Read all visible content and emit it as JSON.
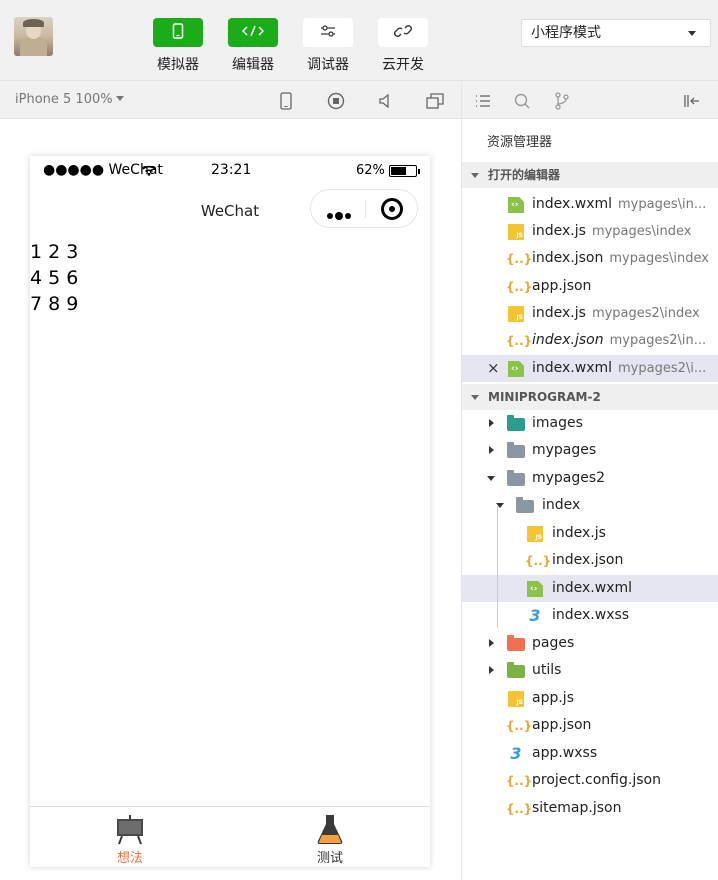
{
  "toolbar": {
    "buttons": [
      {
        "label": "模拟器",
        "icon": "phone-icon",
        "active": true
      },
      {
        "label": "编辑器",
        "icon": "code-icon",
        "active": true
      },
      {
        "label": "调试器",
        "icon": "sliders-icon",
        "active": false
      },
      {
        "label": "云开发",
        "icon": "cloud-link-icon",
        "active": false
      }
    ],
    "mode_select": "小程序模式"
  },
  "simulator": {
    "device": "iPhone 5 100%",
    "status": {
      "carrier": "●●●●● WeChat",
      "time": "23:21",
      "battery": "62%",
      "battery_level": 0.62
    },
    "nav_title": "WeChat",
    "content_lines": [
      "1 2 3",
      "4 5 6",
      "7 8 9"
    ],
    "tabs": [
      {
        "label": "想法",
        "icon": "easel-icon",
        "active": true
      },
      {
        "label": "测试",
        "icon": "flask-icon",
        "active": false
      }
    ]
  },
  "explorer": {
    "title": "资源管理器",
    "open_editors_header": "打开的编辑器",
    "project_header": "MINIPROGRAM-2",
    "open_editors": [
      {
        "name": "index.wxml",
        "path": "mypages\\in...",
        "type": "wxml"
      },
      {
        "name": "index.js",
        "path": "mypages\\index",
        "type": "js"
      },
      {
        "name": "index.json",
        "path": "mypages\\index",
        "type": "json"
      },
      {
        "name": "app.json",
        "path": "",
        "type": "json"
      },
      {
        "name": "index.js",
        "path": "mypages2\\index",
        "type": "js"
      },
      {
        "name": "index.json",
        "path": "mypages2\\in...",
        "type": "json"
      },
      {
        "name": "index.wxml",
        "path": "mypages2\\i...",
        "type": "wxml"
      }
    ],
    "tree": [
      {
        "name": "images"
      },
      {
        "name": "mypages"
      },
      {
        "name": "mypages2"
      },
      {
        "name": "index"
      },
      {
        "name": "index.js"
      },
      {
        "name": "index.json"
      },
      {
        "name": "index.wxml"
      },
      {
        "name": "index.wxss"
      },
      {
        "name": "pages"
      },
      {
        "name": "utils"
      },
      {
        "name": "app.js"
      },
      {
        "name": "app.json"
      },
      {
        "name": "app.wxss"
      },
      {
        "name": "project.config.json"
      },
      {
        "name": "sitemap.json"
      }
    ]
  },
  "colors": {
    "accent_green": "#1aad19",
    "tab_active": "#e8733b",
    "selected_row": "#e4e6f1"
  }
}
